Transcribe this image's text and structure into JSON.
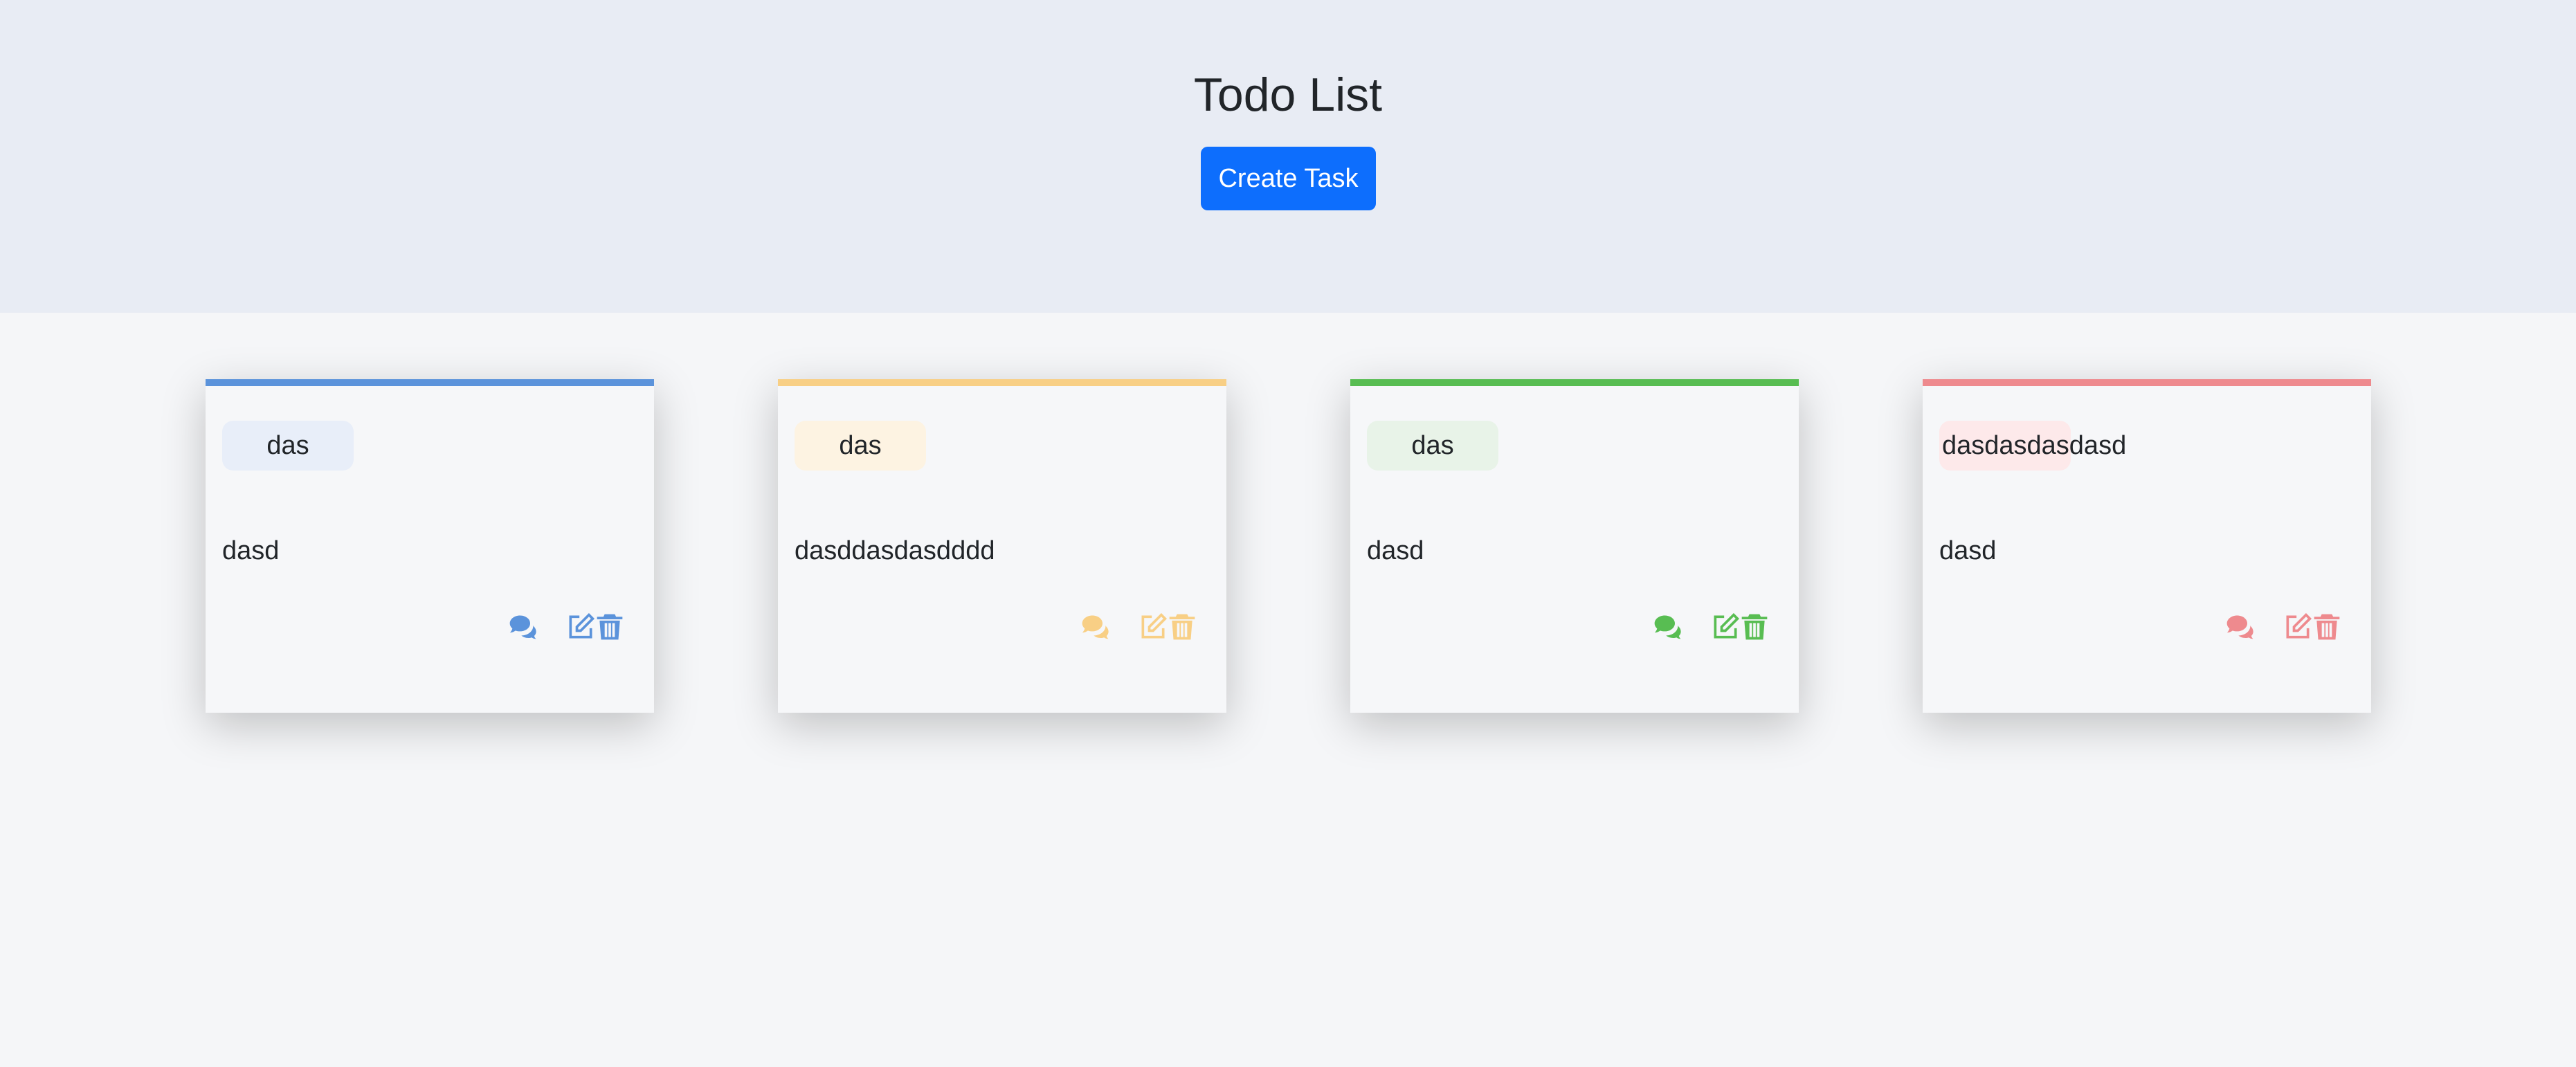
{
  "header": {
    "title": "Todo List",
    "create_label": "Create Task"
  },
  "cards": [
    {
      "badge": "das",
      "description": "dasd",
      "color": "#5b93db",
      "badge_bg": "#e8eef9"
    },
    {
      "badge": "das",
      "description": "dasddasdasdddd",
      "color": "#f8cf85",
      "badge_bg": "#fdf3e2"
    },
    {
      "badge": "das",
      "description": "dasd",
      "color": "#58bd52",
      "badge_bg": "#e8f3e8"
    },
    {
      "badge": "dasdasdasdasd",
      "description": "dasd",
      "color": "#ee8a8e",
      "badge_bg": "#fde9ea"
    }
  ],
  "icons": {
    "comment": "comments-icon",
    "edit": "edit-icon",
    "delete": "trash-icon"
  }
}
